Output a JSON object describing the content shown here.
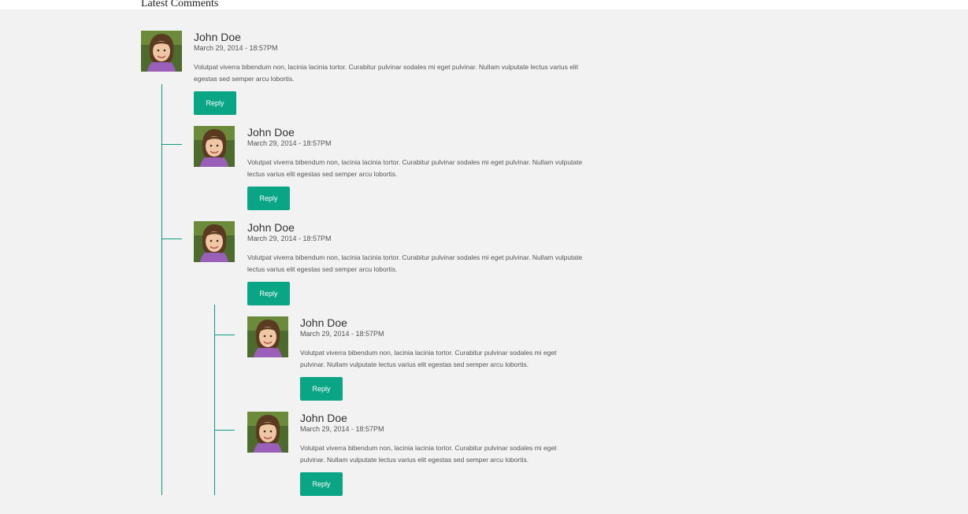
{
  "section": {
    "title": "Latest Comments"
  },
  "comments": [
    {
      "author": "John Doe",
      "date": "March 29, 2014 - 18:57PM",
      "text": "Volutpat viverra bibendum non, lacinia lacinia tortor. Curabitur pulvinar sodales mi eget pulvinar. Nullam vulputate lectus varius elit egestas sed semper arcu lobortis.",
      "reply_label": "Reply"
    },
    {
      "author": "John Doe",
      "date": "March 29, 2014 - 18:57PM",
      "text": "Volutpat viverra bibendum non, lacinia lacinia tortor. Curabitur pulvinar sodales mi eget pulvinar. Nullam vulputate lectus varius elit egestas sed semper arcu lobortis.",
      "reply_label": "Reply"
    },
    {
      "author": "John Doe",
      "date": "March 29, 2014 - 18:57PM",
      "text": "Volutpat viverra bibendum non, lacinia lacinia tortor. Curabitur pulvinar sodales mi eget pulvinar. Nullam vulputate lectus varius elit egestas sed semper arcu lobortis.",
      "reply_label": "Reply"
    },
    {
      "author": "John Doe",
      "date": "March 29, 2014 - 18:57PM",
      "text": "Volutpat viverra bibendum non, lacinia lacinia tortor. Curabitur pulvinar sodales mi eget pulvinar. Nullam vulputate lectus varius elit egestas sed semper arcu lobortis.",
      "reply_label": "Reply"
    },
    {
      "author": "John Doe",
      "date": "March 29, 2014 - 18:57PM",
      "text": "Volutpat viverra bibendum non, lacinia lacinia tortor. Curabitur pulvinar sodales mi eget pulvinar. Nullam vulputate lectus varius elit egestas sed semper arcu lobortis.",
      "reply_label": "Reply"
    }
  ],
  "colors": {
    "accent": "#0aa585",
    "thread_line": "#0d9b82",
    "background": "#f2f2f2"
  },
  "icons": {
    "avatar": "avatar-photo-girl"
  }
}
